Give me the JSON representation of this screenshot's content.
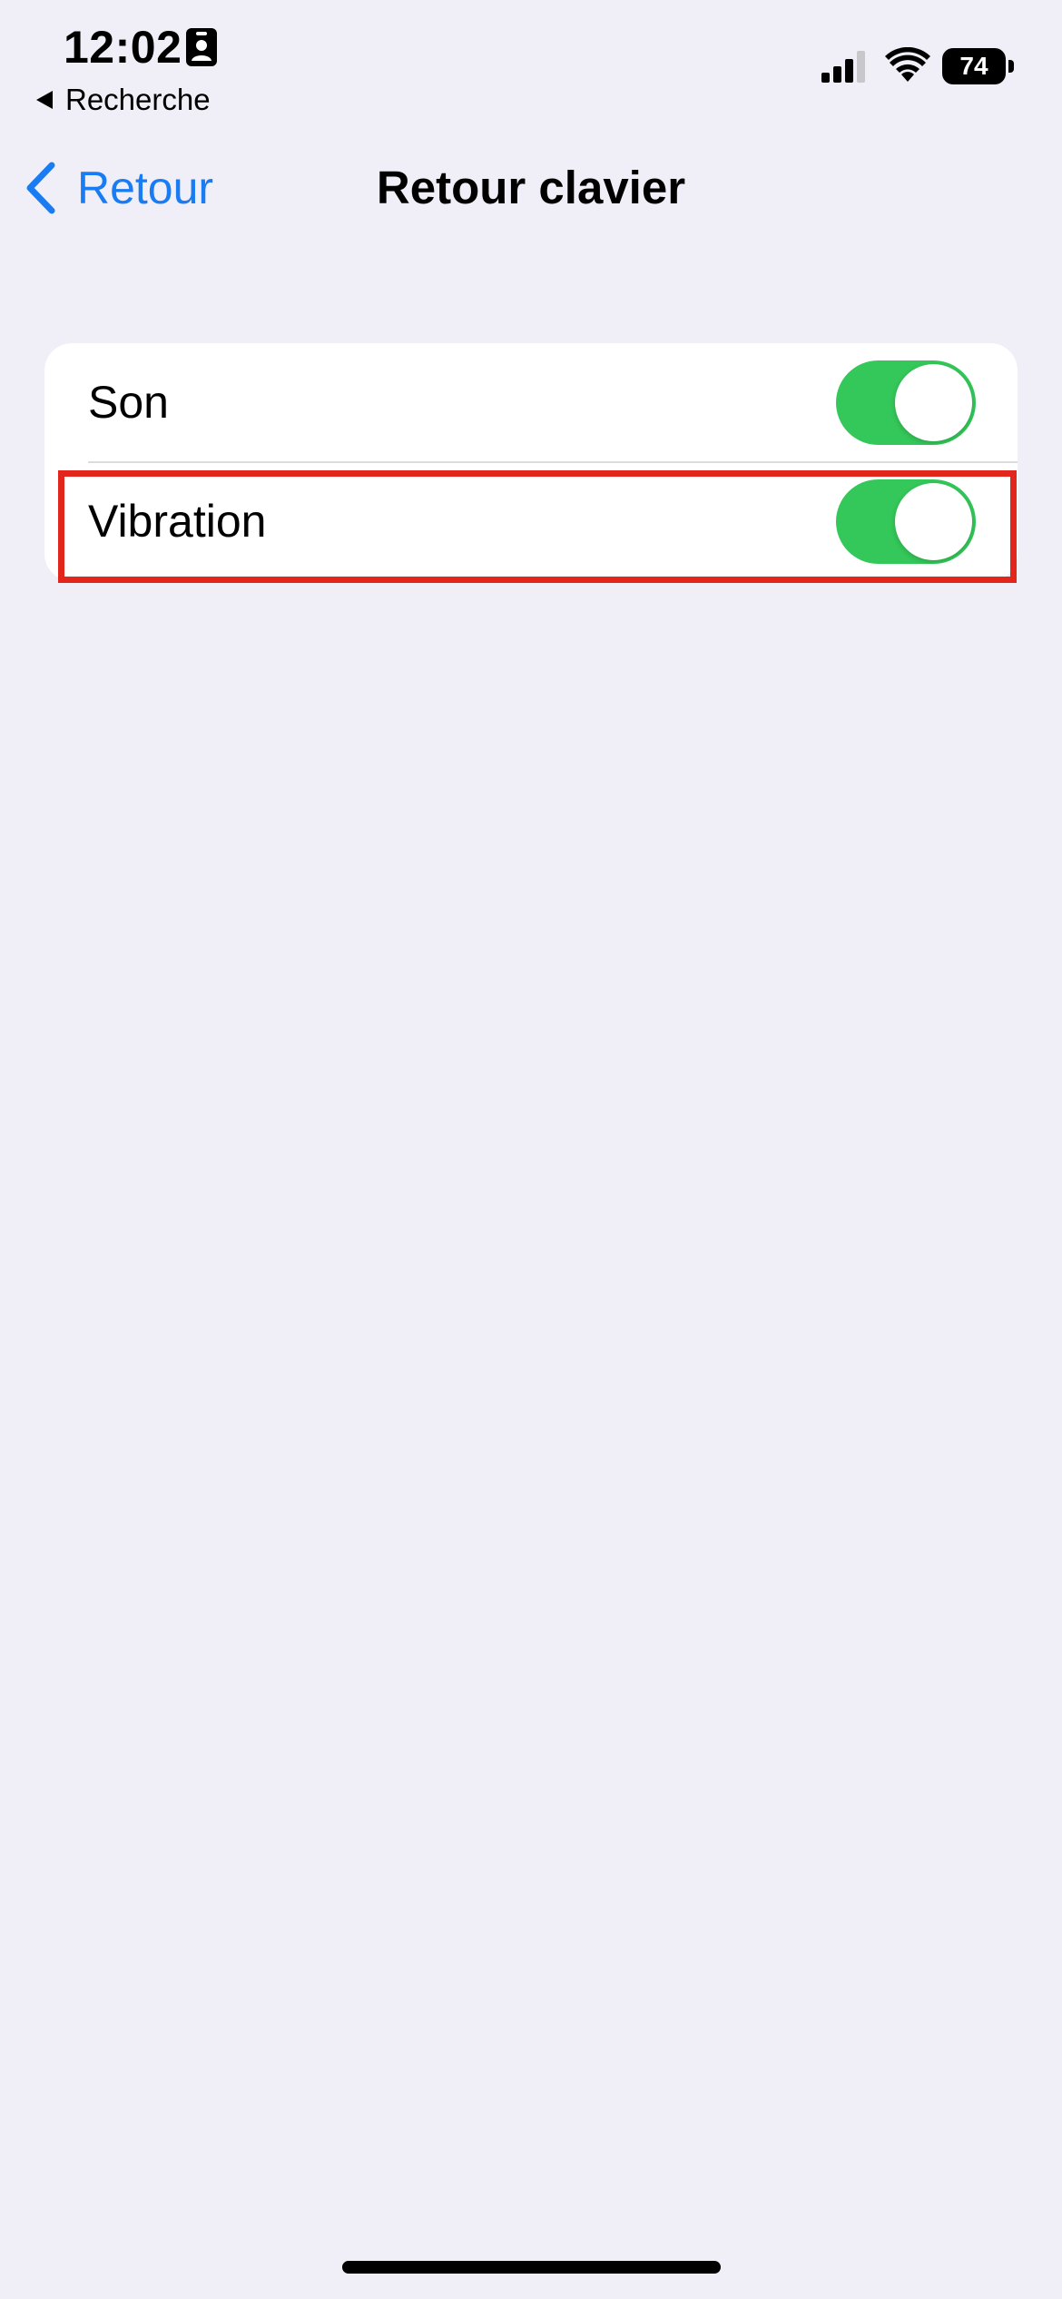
{
  "status_bar": {
    "time": "12:02",
    "back_app_label": "Recherche",
    "battery_level": "74",
    "icons": [
      "id-badge-icon",
      "signal-icon",
      "wifi-icon",
      "battery-icon"
    ]
  },
  "nav": {
    "back_label": "Retour",
    "title": "Retour clavier"
  },
  "settings": {
    "rows": [
      {
        "label": "Son",
        "toggle_on": true
      },
      {
        "label": "Vibration",
        "toggle_on": true
      }
    ]
  },
  "colors": {
    "background": "#f0eef6",
    "accent_blue": "#1a7cf2",
    "toggle_on": "#34c759",
    "highlight": "#e3261b"
  }
}
